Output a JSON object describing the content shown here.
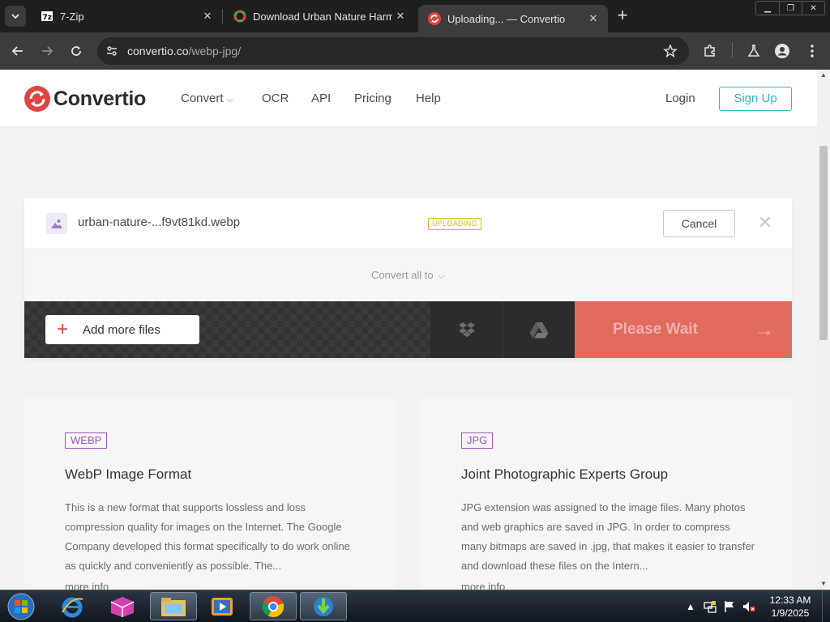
{
  "browser": {
    "tabs": [
      {
        "title": "7-Zip",
        "icon": "7zip-icon",
        "active": false
      },
      {
        "title": "Download Urban Nature Harm",
        "icon": "color-wheel-icon",
        "active": false
      },
      {
        "title": "Uploading... — Convertio",
        "icon": "convertio-icon",
        "active": true
      }
    ],
    "url_host": "convertio.co",
    "url_path": "/webp-jpg/"
  },
  "site": {
    "brand": "Convertio",
    "nav": {
      "convert": "Convert",
      "ocr": "OCR",
      "api": "API",
      "pricing": "Pricing",
      "help": "Help"
    },
    "login": "Login",
    "signup": "Sign Up",
    "brand_color": "#e0443f",
    "accent_color": "#3ab0c4"
  },
  "upload": {
    "file_name": "urban-nature-...f9vt81kd.webp",
    "status": "UPLOADING",
    "cancel": "Cancel",
    "convert_all": "Convert all to",
    "add_files": "Add more files",
    "wait": "Please Wait",
    "cloud_icons": [
      "dropbox-icon",
      "google-drive-icon"
    ]
  },
  "formats": [
    {
      "badge": "WEBP",
      "title": "WebP Image Format",
      "description": "This is a new format that supports lossless and loss compression quality for images on the Internet. The Google Company developed this format specifically to do work online as quickly and conveniently as possible. The...",
      "more": "more info"
    },
    {
      "badge": "JPG",
      "title": "Joint Photographic Experts Group",
      "description": "JPG extension was assigned to the image files. Many photos and web graphics are saved in JPG. In order to compress many bitmaps are saved in .jpg, that makes it easier to transfer and download these files on the Intern...",
      "more": "more info"
    }
  ],
  "taskbar": {
    "time": "12:33 AM",
    "date": "1/9/2025",
    "apps": [
      "internet-explorer-icon",
      "app-icon",
      "file-explorer-icon",
      "media-player-icon",
      "chrome-icon",
      "download-manager-icon"
    ]
  }
}
